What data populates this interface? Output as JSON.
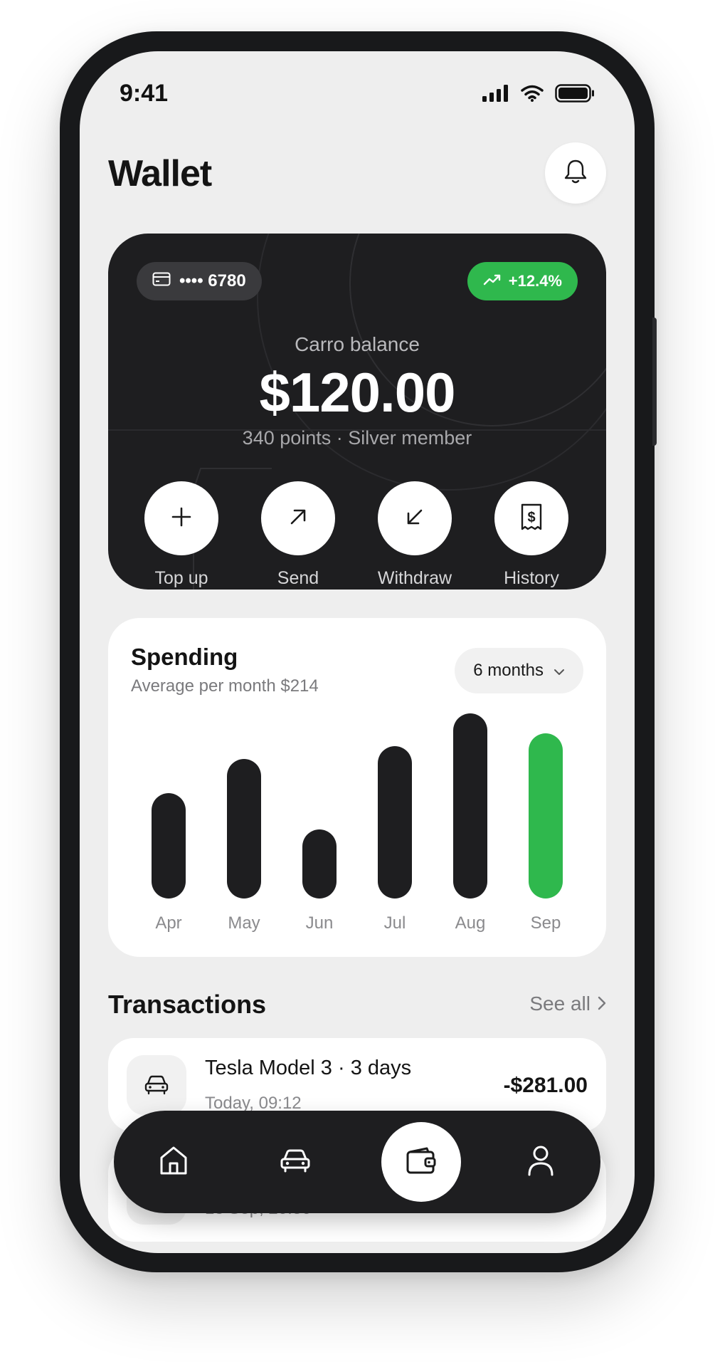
{
  "status_bar": {
    "time": "9:41"
  },
  "header": {
    "title": "Wallet"
  },
  "balance_card": {
    "card_masked": "•••• 6780",
    "growth": "+12.4%",
    "label": "Carro balance",
    "amount": "$120.00",
    "subtitle": "340 points · Silver member",
    "actions": [
      {
        "label": "Top up",
        "icon": "plus-icon"
      },
      {
        "label": "Send",
        "icon": "arrow-up-right-icon"
      },
      {
        "label": "Withdraw",
        "icon": "arrow-down-left-icon"
      },
      {
        "label": "History",
        "icon": "receipt-icon"
      }
    ]
  },
  "spending": {
    "title": "Spending",
    "subtitle": "Average per month $214",
    "range": "6 months"
  },
  "chart_data": {
    "type": "bar",
    "categories": [
      "Apr",
      "May",
      "Jun",
      "Jul",
      "Aug",
      "Sep"
    ],
    "values": [
      148,
      196,
      97,
      214,
      260,
      232
    ],
    "highlight_index": 5,
    "colors": {
      "default": "#1e1e20",
      "highlight": "#2fb84d"
    },
    "grid": false
  },
  "transactions": {
    "title": "Transactions",
    "see_all": "See all",
    "items": [
      {
        "name": "Tesla Model 3 · 3 days",
        "date": "Today, 09:12",
        "amount": "-$281.00",
        "icon": "car-icon"
      },
      {
        "name": "",
        "date": "18 Sep, 20:30",
        "amount": "",
        "icon": ""
      }
    ]
  },
  "bottom_nav": {
    "items": [
      {
        "icon": "home-icon"
      },
      {
        "icon": "car-icon"
      },
      {
        "icon": "wallet-icon",
        "active": true
      },
      {
        "icon": "user-icon"
      }
    ]
  },
  "colors": {
    "accent": "#2fb84d",
    "dark": "#1e1e20",
    "background": "#eeeeee"
  }
}
